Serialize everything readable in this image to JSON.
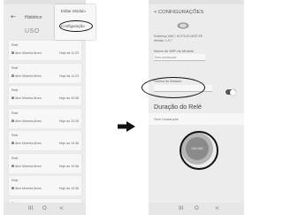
{
  "left_screen": {
    "header": {
      "title": "Histórico",
      "tab_label": "USO"
    },
    "menu": {
      "items": [
        {
          "label": "Editar Módulo"
        },
        {
          "label": "Configuração"
        }
      ]
    },
    "history": [
      {
        "title": "Relé",
        "user": "Alex Moreira Alves",
        "time": "Hoje às 11:23"
      },
      {
        "title": "Relé",
        "user": "Alex Moreira Alves",
        "time": "Hoje às 11:23"
      },
      {
        "title": "Relé",
        "user": "Alex Moreira Alves",
        "time": "Hoje às 10:36"
      },
      {
        "title": "Relé",
        "user": "Alex Moreira Alves",
        "time": "Hoje às 10:36"
      },
      {
        "title": "Relé",
        "user": "Alex Moreira Alves",
        "time": "Hoje às 10:36"
      },
      {
        "title": "Relé",
        "user": "Alex Moreira Alves",
        "time": "Hoje às 10:36"
      },
      {
        "title": "Relé",
        "user": "Alex Moreira Alves",
        "time": "Hoje às 10:36"
      },
      {
        "title": "Relé",
        "user": "Alex Moreira Alves",
        "time": "Hoje às 10:36"
      }
    ]
  },
  "right_screen": {
    "header": {
      "title": "< CONFIGURAÇÕES"
    },
    "info": {
      "mac": "Endereço MAC: 4C:F3:22:18:57:F6",
      "version": "Versão: 1.0.7"
    },
    "wifi_name": {
      "label": "Nome do WiFi do Módulo",
      "value": "Sem mudanças"
    },
    "module_password": {
      "label": "Senha do Módulo",
      "toggle_on": true
    },
    "relay_duration": {
      "title": "Duração do Relé",
      "value": "Sem mudanças"
    },
    "save_label": "SALVAR"
  },
  "nav_bar": {
    "recent": "III",
    "home": "O",
    "back": "<"
  },
  "colors": {
    "background": "#ececec",
    "card": "#f7f7f7",
    "annotation": "#111111",
    "save_button": "#8a8a8a"
  }
}
